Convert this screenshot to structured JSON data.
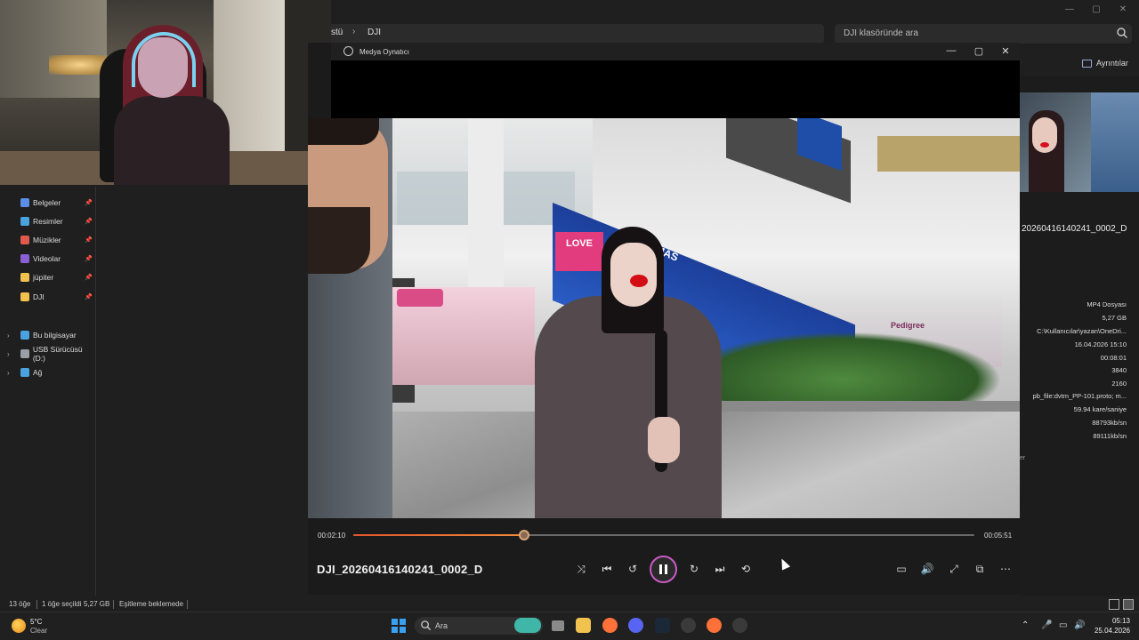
{
  "explorer": {
    "breadcrumb": [
      "stü",
      "DJI"
    ],
    "breadcrumb_sep": "›",
    "search_placeholder": "DJI klasöründe ara",
    "details_label": "Ayrıntılar",
    "window_controls": [
      "—",
      "▢",
      "✕"
    ]
  },
  "sidebar": {
    "items": [
      {
        "label": "Belgeler",
        "icon": "document-icon",
        "color": "#5b8ee6",
        "pinned": true
      },
      {
        "label": "Resimler",
        "icon": "pictures-icon",
        "color": "#4aa3df",
        "pinned": true
      },
      {
        "label": "Müzikler",
        "icon": "music-icon",
        "color": "#e05a4e",
        "pinned": true
      },
      {
        "label": "Videolar",
        "icon": "video-icon",
        "color": "#8a5fd6",
        "pinned": true
      },
      {
        "label": "jüpiter",
        "icon": "folder-icon",
        "color": "#f2c24e",
        "pinned": true
      },
      {
        "label": "DJI",
        "icon": "folder-icon",
        "color": "#f2c24e",
        "pinned": true
      }
    ],
    "drives": [
      {
        "label": "Bu bilgisayar",
        "icon": "computer-icon",
        "color": "#4aa3df"
      },
      {
        "label": "USB Sürücüsü (D:)",
        "icon": "usb-drive-icon",
        "color": "#9aa0a6"
      },
      {
        "label": "Ağ",
        "icon": "network-icon",
        "color": "#4aa3df"
      }
    ],
    "pin_glyph": "📌",
    "chevron": "›"
  },
  "statusbar": {
    "count": "13 öğe",
    "selected": "1 öğe seçildi",
    "size": "5,27 GB",
    "sync": "Eşitleme beklemede"
  },
  "details": {
    "file_name": "20260416140241_0002_D",
    "values": [
      "MP4 Dosyası",
      "5,27 GB",
      "C:\\Kullanıcılar\\yazan\\OneDri...",
      "16.04.2026 15:10",
      "00:08:01",
      "3840",
      "2160",
      "pb_file:dvtm_PP-101.proto; m...",
      "59.94 kare/saniye",
      "88793kb/sn",
      "89111kb/sn"
    ],
    "misc": "er"
  },
  "player": {
    "app_title": "Medya Oynatıcı",
    "file_title": "DJI_20260416140241_0002_D",
    "time_current": "00:02:10",
    "time_total": "00:05:51",
    "progress": 0.275,
    "accent": "#e4572e",
    "play_ring": "#c95ac6",
    "window_controls": [
      "—",
      "▢",
      "✕"
    ],
    "controls_left": [
      {
        "name": "shuffle-icon",
        "glyph": "⤨"
      },
      {
        "name": "previous-icon",
        "glyph": "⏮"
      },
      {
        "name": "rewind-10-icon",
        "glyph": "↺"
      }
    ],
    "controls_right_transport": [
      {
        "name": "forward-30-icon",
        "glyph": "↻"
      },
      {
        "name": "next-icon",
        "glyph": "⏭"
      },
      {
        "name": "repeat-icon",
        "glyph": "⟲"
      }
    ],
    "controls_right": [
      {
        "name": "subtitles-icon",
        "glyph": "▭"
      },
      {
        "name": "volume-icon",
        "glyph": "🔊"
      },
      {
        "name": "fullscreen-icon",
        "glyph": "⤢"
      },
      {
        "name": "mini-player-icon",
        "glyph": "⧉"
      },
      {
        "name": "more-icon",
        "glyph": "⋯"
      }
    ]
  },
  "video_scene": {
    "signs": [
      "CINEMAS",
      "LOVE",
      "Pedigree"
    ]
  },
  "taskbar": {
    "weather_temp": "5°C",
    "weather_desc": "Clear",
    "search_label": "Ara",
    "time": "05:13",
    "date": "25.04.2026",
    "apps": [
      {
        "name": "file-explorer-icon",
        "color": "#f2c24e"
      },
      {
        "name": "firefox-icon",
        "color": "#ff7139"
      },
      {
        "name": "discord-icon",
        "color": "#5865f2"
      },
      {
        "name": "steam-icon",
        "color": "#1b2838"
      },
      {
        "name": "obs-icon",
        "color": "#3a3a3a"
      },
      {
        "name": "firefox-alt-icon",
        "color": "#ff7139"
      },
      {
        "name": "media-player-icon",
        "color": "#3a3a3a"
      }
    ],
    "tray": [
      "⌃",
      "🎤",
      "▭",
      "🔊"
    ]
  }
}
